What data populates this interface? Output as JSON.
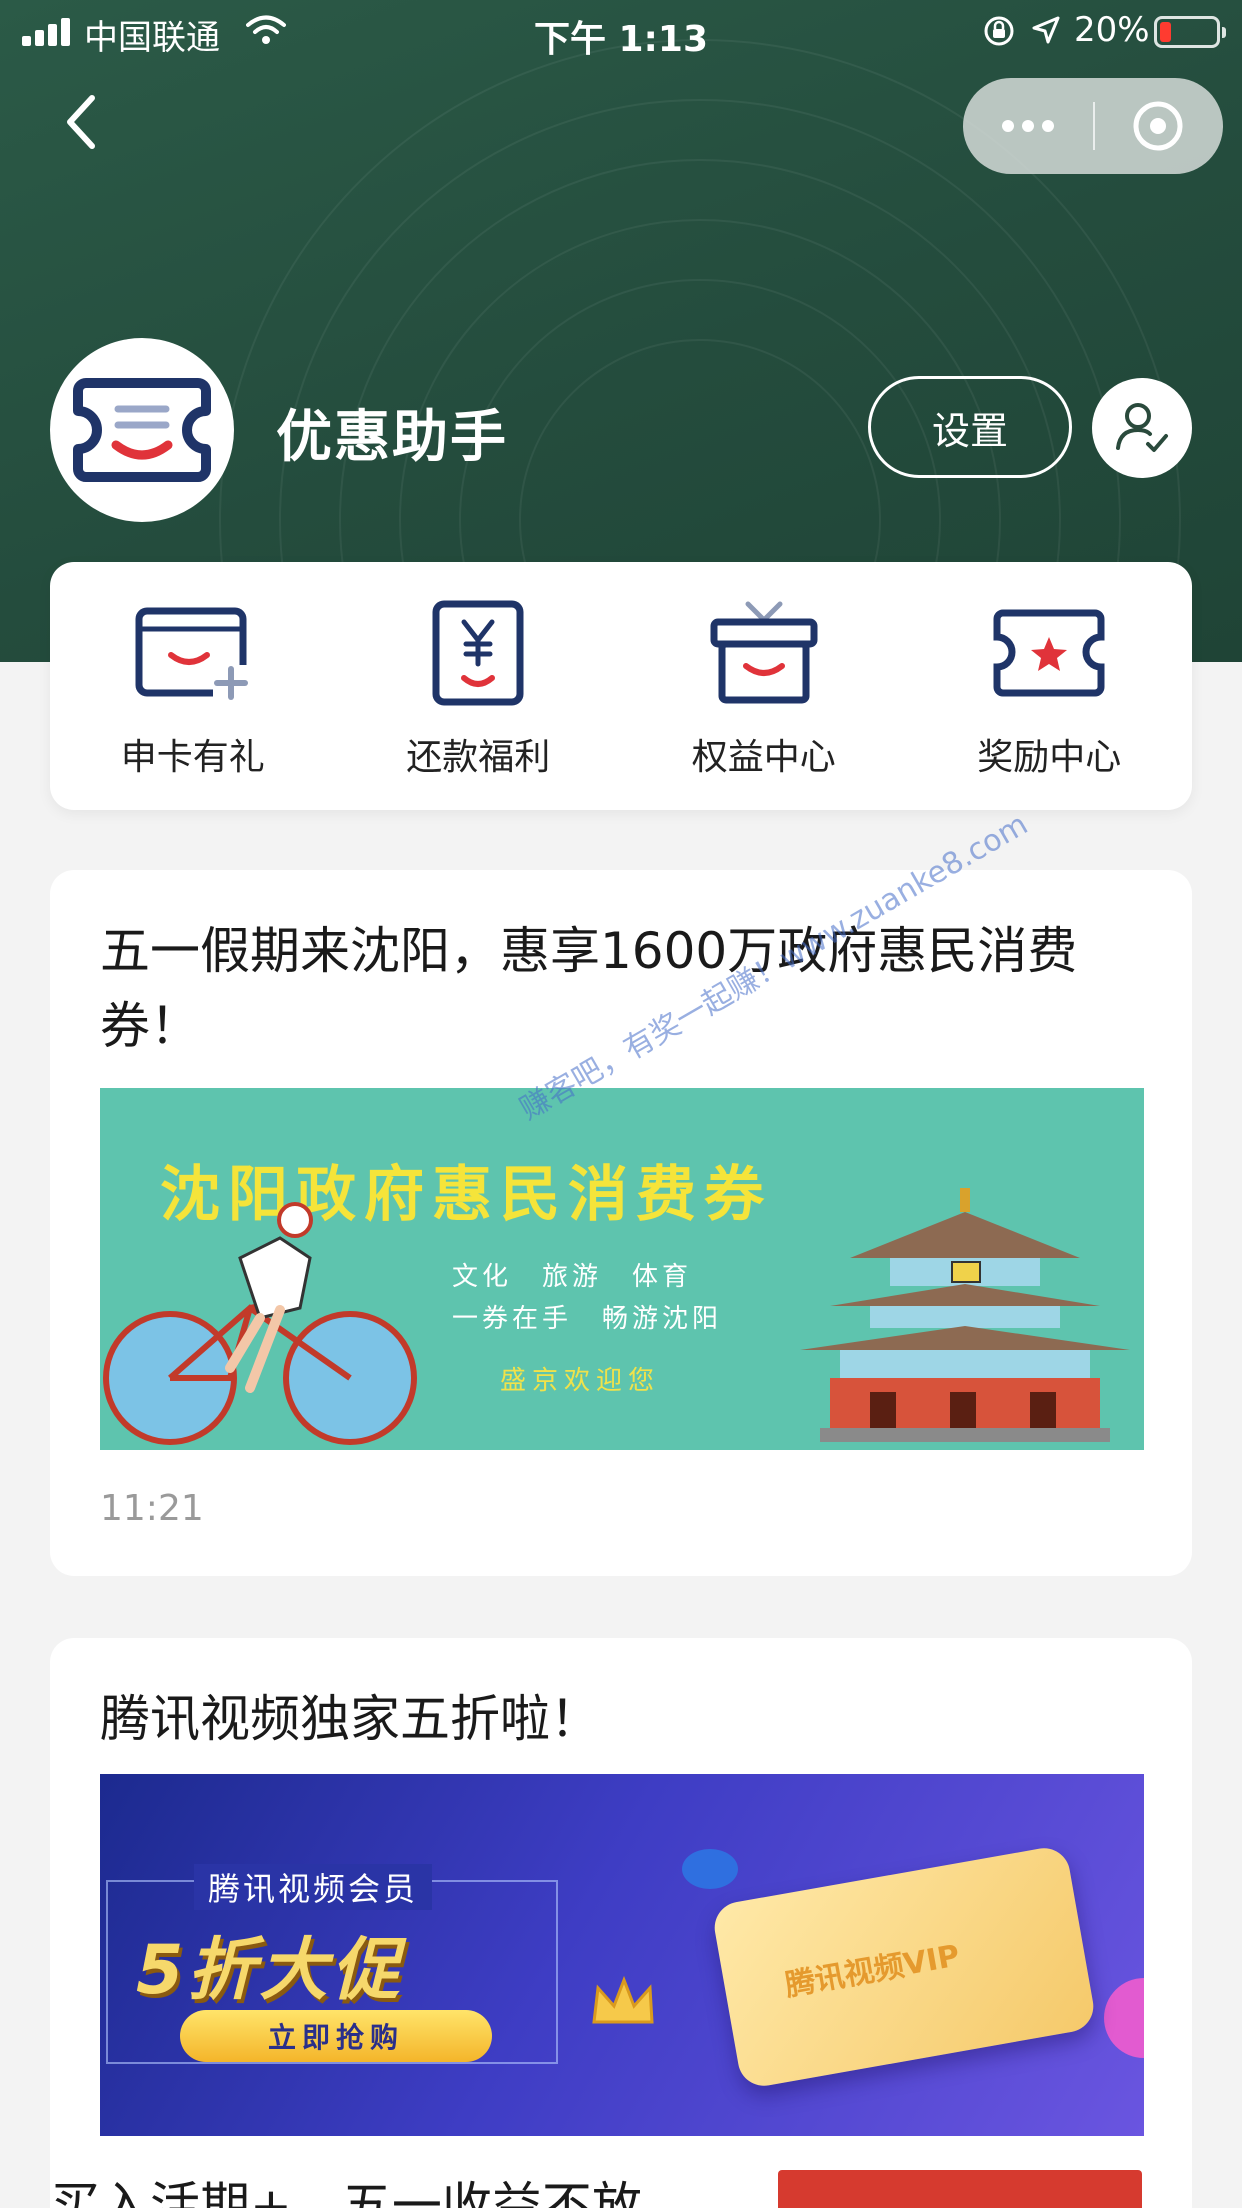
{
  "status_bar": {
    "carrier": "中国联通",
    "time": "下午 1:13",
    "battery_percent": "20%",
    "battery_level": 0.2
  },
  "nav": {
    "back_icon": "chevron-left-icon",
    "more_icon": "more-dots-icon",
    "close_icon": "close-circle-icon"
  },
  "profile": {
    "name": "优惠助手",
    "settings_label": "设置",
    "profile_icon": "user-check-icon"
  },
  "quick_menu": [
    {
      "label": "申卡有礼",
      "icon": "card-add-icon"
    },
    {
      "label": "还款福利",
      "icon": "yen-repay-icon"
    },
    {
      "label": "权益中心",
      "icon": "gift-box-icon"
    },
    {
      "label": "奖励中心",
      "icon": "star-ticket-icon"
    }
  ],
  "feed": [
    {
      "title": "五一假期来沈阳，惠享1600万政府惠民消费券！",
      "time": "11:21",
      "banner": {
        "title": "沈阳政府惠民消费券",
        "line1": "文化　旅游　体育",
        "line2": "一券在手　畅游沈阳",
        "welcome": "盛京欢迎您"
      }
    },
    {
      "title": "腾讯视频独家五折啦！",
      "banner": {
        "subtitle": "腾讯视频会员",
        "big": "5折大促",
        "buy": "立即抢购",
        "card_label": "腾讯视频VIP"
      }
    },
    {
      "title": "买入活期+，五一收益不放"
    }
  ],
  "watermark": "赚客吧，有奖一起赚！www.zuanke8.com",
  "colors": {
    "header_green": "#244c3d",
    "brand_blue": "#1f3468",
    "brand_red": "#e0333a",
    "banner_teal": "#5ec4ae"
  }
}
